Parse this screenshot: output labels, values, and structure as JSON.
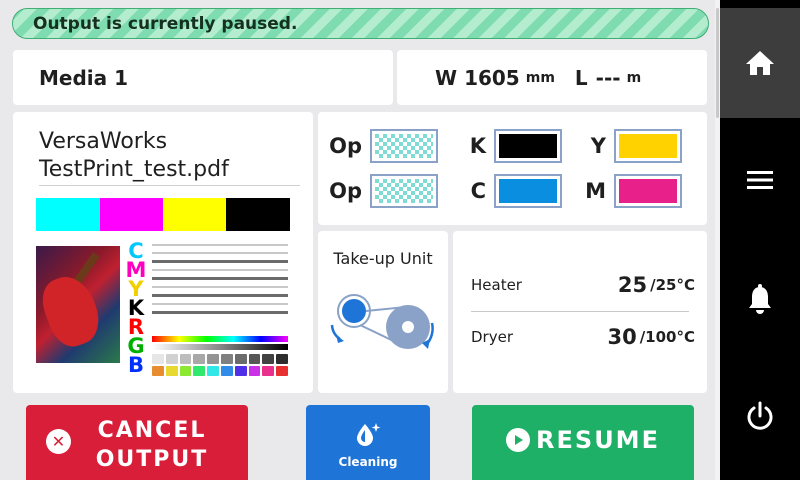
{
  "status": {
    "message": "Output is currently paused."
  },
  "media": {
    "name": "Media 1"
  },
  "media_size": {
    "width_label": "W",
    "width_value": "1605",
    "width_unit": "mm",
    "length_label": "L",
    "length_value": "---",
    "length_unit": "m"
  },
  "job": {
    "app": "VersaWorks",
    "file": "TestPrint_test.pdf",
    "thumb_letters": [
      "C",
      "M",
      "Y",
      "K",
      "R",
      "G",
      "B"
    ]
  },
  "inks": [
    {
      "label": "Op",
      "color": "checker"
    },
    {
      "label": "K",
      "color": "#000000"
    },
    {
      "label": "Y",
      "color": "#ffd200"
    },
    {
      "label": "Op",
      "color": "checker"
    },
    {
      "label": "C",
      "color": "#0a8fe0"
    },
    {
      "label": "M",
      "color": "#e8218a"
    }
  ],
  "takeup": {
    "title": "Take-up Unit"
  },
  "temps": [
    {
      "name": "Heater",
      "current": "25",
      "set": "/25°C"
    },
    {
      "name": "Dryer",
      "current": "30",
      "set": "/100°C"
    }
  ],
  "buttons": {
    "cancel_line1": "CANCEL",
    "cancel_line2": "OUTPUT",
    "cleaning": "Cleaning",
    "resume": "RESUME"
  },
  "sidebar": {
    "items": [
      "home-icon",
      "menu-icon",
      "bell-icon",
      "power-icon"
    ]
  },
  "colors": {
    "cancel": "#d91e3a",
    "cleaning": "#1f74d8",
    "resume": "#1fb068",
    "banner": "#7fdcb0"
  }
}
